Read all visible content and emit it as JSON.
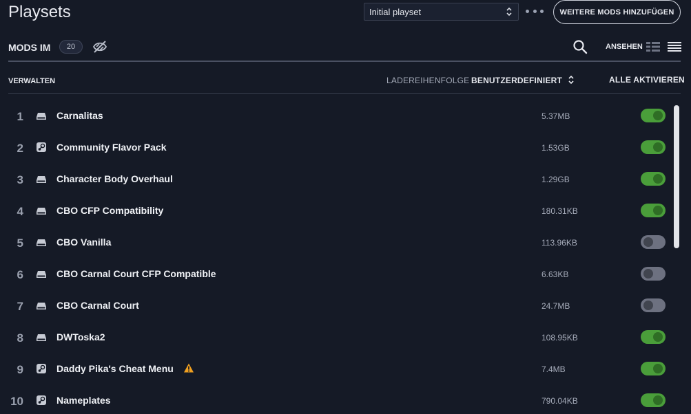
{
  "header": {
    "title": "Playsets",
    "playset_select": "Initial playset",
    "more_icon": "more-dots-icon",
    "add_mods_label": "WEITERE MODS HINZUFÜGEN"
  },
  "toolbar": {
    "mods_label": "MODS IM",
    "mod_count": "20",
    "view_label": "ANSEHEN"
  },
  "subheader": {
    "manage_label": "VERWALTEN",
    "load_order_label": "LADEREIHENFOLGE",
    "load_order_value": "BENUTZERDEFINIERT",
    "activate_all_label": "ALLE AKTIVIEREN"
  },
  "colors": {
    "background": "#151a26",
    "toggle_on": "#4a9e3a",
    "toggle_off": "#6d7180",
    "warning": "#f0a020"
  },
  "mods": [
    {
      "num": "1",
      "source": "local",
      "name": "Carnalitas",
      "size": "5.37MB",
      "enabled": true,
      "warning": false
    },
    {
      "num": "2",
      "source": "steam",
      "name": "Community Flavor Pack",
      "size": "1.53GB",
      "enabled": true,
      "warning": false
    },
    {
      "num": "3",
      "source": "local",
      "name": "Character Body Overhaul",
      "size": "1.29GB",
      "enabled": true,
      "warning": false
    },
    {
      "num": "4",
      "source": "local",
      "name": "CBO CFP Compatibility",
      "size": "180.31KB",
      "enabled": true,
      "warning": false
    },
    {
      "num": "5",
      "source": "local",
      "name": "CBO Vanilla",
      "size": "113.96KB",
      "enabled": false,
      "warning": false
    },
    {
      "num": "6",
      "source": "local",
      "name": "CBO Carnal Court CFP Compatible",
      "size": "6.63KB",
      "enabled": false,
      "warning": false
    },
    {
      "num": "7",
      "source": "local",
      "name": "CBO Carnal Court",
      "size": "24.7MB",
      "enabled": false,
      "warning": false
    },
    {
      "num": "8",
      "source": "local",
      "name": "DWToska2",
      "size": "108.95KB",
      "enabled": true,
      "warning": false
    },
    {
      "num": "9",
      "source": "steam",
      "name": "Daddy Pika's Cheat Menu",
      "size": "7.4MB",
      "enabled": true,
      "warning": true
    },
    {
      "num": "10",
      "source": "steam",
      "name": "Nameplates",
      "size": "790.04KB",
      "enabled": true,
      "warning": false
    }
  ]
}
